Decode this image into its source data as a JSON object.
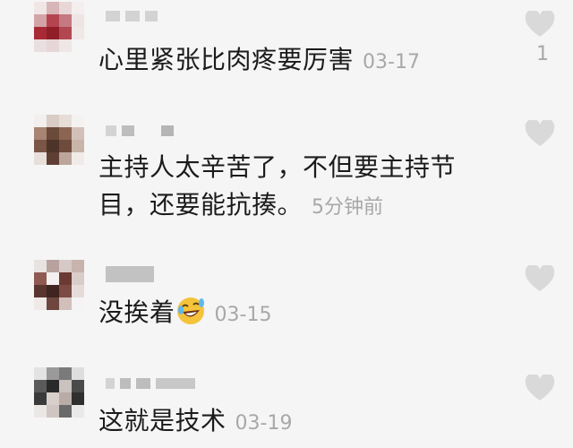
{
  "comments": [
    {
      "text": "心里紧张比肉疼要厉害",
      "time": "03-17",
      "like_count": "1",
      "avatar_color": "#9b2630"
    },
    {
      "text": "主持人太辛苦了，不但要主持节目，还要能抗揍。",
      "time": "5分钟前",
      "like_count": "",
      "avatar_color": "#6b4a3a"
    },
    {
      "text": "没挨着",
      "emoji": "rolling-laughing-emoji",
      "time": "03-15",
      "like_count": "",
      "avatar_color": "#5a3530"
    },
    {
      "text": "这就是技术",
      "time": "03-19",
      "like_count": "",
      "avatar_color": "#2a2a2a"
    }
  ],
  "icons": {
    "like": "heart-icon",
    "avatar": "pixelated-avatar"
  },
  "colors": {
    "background": "#f5f5f5",
    "text": "#1b1b1b",
    "meta": "#a8a8a8",
    "heart": "#d9d9d9"
  }
}
